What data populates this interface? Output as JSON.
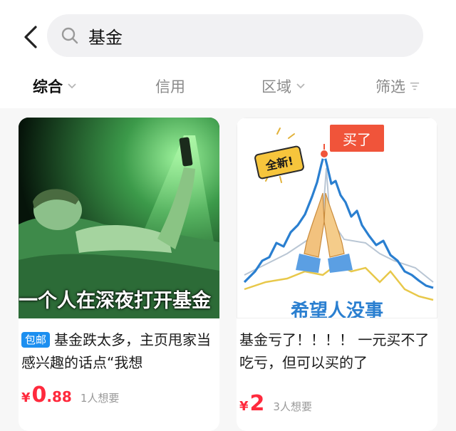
{
  "search": {
    "query": "基金"
  },
  "filters": {
    "tabs": [
      {
        "label": "综合",
        "active": true,
        "icon": "chevron-down-icon"
      },
      {
        "label": "信用",
        "active": false
      },
      {
        "label": "区域",
        "active": false,
        "icon": "chevron-down-icon"
      },
      {
        "label": "筛选",
        "active": false,
        "icon": "filter-icon"
      }
    ]
  },
  "products": [
    {
      "image_caption": "一个人在深夜打开基金",
      "badge": "包邮",
      "title": "基金跌太多，主页甩家当 感兴趣的话点“我想",
      "currency": "¥",
      "price_int": "0",
      "price_dec": ".88",
      "wants": "1人想要"
    },
    {
      "image_sticker": "全新!",
      "image_bubble": "买了",
      "image_caption": "希望人没事",
      "title": "基金亏了！！！！ 一元买不了吃亏，但可以买的了",
      "currency": "¥",
      "price_int": "2",
      "price_dec": "",
      "wants": "3人想要"
    }
  ],
  "colors": {
    "price": "#ff2a3d",
    "badge": "#1c8ff0",
    "chart_line": "#2a7fd0",
    "bubble": "#f0543a"
  }
}
